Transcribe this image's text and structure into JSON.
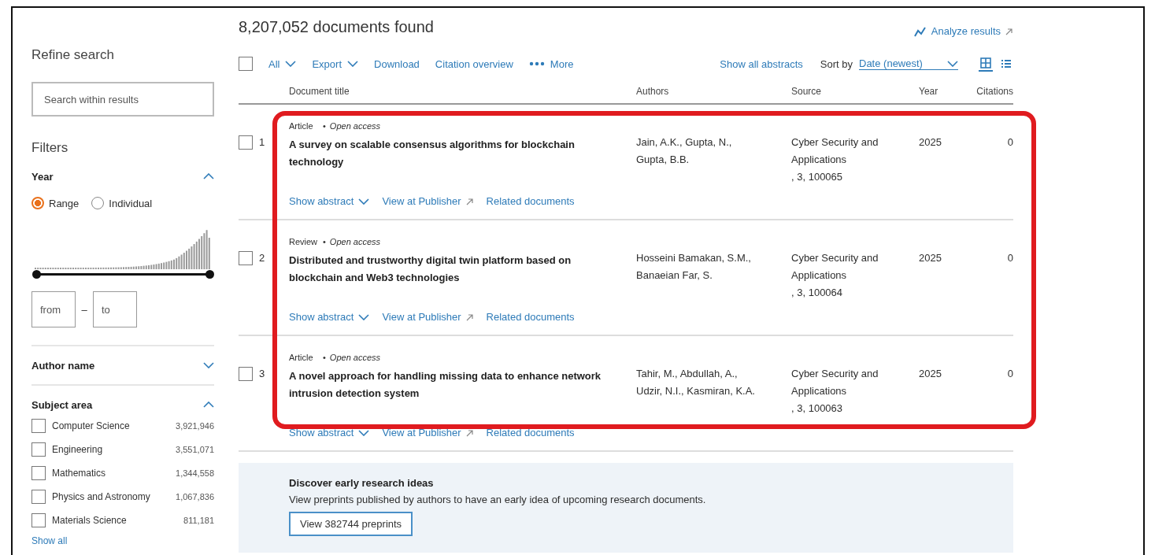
{
  "results_count": "8,207,052 documents found",
  "analyze_link": "Analyze results",
  "sidebar": {
    "title": "Refine search",
    "search": {
      "placeholder": "Search within results"
    },
    "filters_title": "Filters",
    "year": {
      "label": "Year",
      "expanded": true,
      "modes": [
        {
          "label": "Range",
          "selected": true
        },
        {
          "label": "Individual",
          "selected": false
        }
      ],
      "range_low": {
        "level": 0
      },
      "range_high": {
        "level": 1
      },
      "from": {
        "placeholder": "from"
      },
      "separator": "–",
      "to": {
        "placeholder": "to"
      }
    },
    "sections": [
      {
        "label": "Author name",
        "expanded": false
      },
      {
        "label": "Subject area",
        "expanded": true,
        "items": [
          {
            "label": "Computer Science",
            "count": "3,921,946",
            "checked": false
          },
          {
            "label": "Engineering",
            "count": "3,551,071",
            "checked": false
          },
          {
            "label": "Mathematics",
            "count": "1,344,558",
            "checked": false
          },
          {
            "label": "Physics and Astronomy",
            "count": "1,067,836",
            "checked": false
          },
          {
            "label": "Materials Science",
            "count": "811,181",
            "checked": false
          }
        ],
        "show_all": "Show all"
      }
    ]
  },
  "toolbar": {
    "select_all_checked": false,
    "actions": [
      {
        "label": "All",
        "kind": "dropdown"
      },
      {
        "label": "Export",
        "kind": "dropdown"
      },
      {
        "label": "Download",
        "kind": "link"
      },
      {
        "label": "Citation overview",
        "kind": "link"
      },
      {
        "label": "More",
        "kind": "more"
      }
    ],
    "show_all_abstracts": "Show all abstracts",
    "sort_label": "Sort by",
    "sort_value": "Date (newest)",
    "views": [
      {
        "kind": "grid",
        "selected": true
      },
      {
        "kind": "list",
        "selected": false
      }
    ]
  },
  "table": {
    "columns": [
      "Document title",
      "Authors",
      "Source",
      "Year",
      "Citations"
    ],
    "rows": [
      {
        "number": "1",
        "checked": false,
        "type": "Article",
        "separator": "•",
        "access": "Open access",
        "title": "A survey on scalable consensus algorithms for blockchain technology",
        "authors": [
          "Jain, A.K., Gupta, N.,",
          "Gupta, B.B."
        ],
        "source": "Cyber Security and Applications",
        "source_detail": ", 3, 100065",
        "year": "2025",
        "citations": "0",
        "links": [
          {
            "label": "Show abstract",
            "kind": "expand"
          },
          {
            "label": "View at Publisher",
            "kind": "external"
          },
          {
            "label": "Related documents",
            "kind": "link"
          }
        ]
      },
      {
        "number": "2",
        "checked": false,
        "type": "Review",
        "separator": "•",
        "access": "Open access",
        "title": "Distributed and trustworthy digital twin platform based on blockchain and Web3 technologies",
        "authors": [
          "Hosseini Bamakan, S.M.,",
          "Banaeian Far, S."
        ],
        "source": "Cyber Security and Applications",
        "source_detail": ", 3, 100064",
        "year": "2025",
        "citations": "0",
        "links": [
          {
            "label": "Show abstract",
            "kind": "expand"
          },
          {
            "label": "View at Publisher",
            "kind": "external"
          },
          {
            "label": "Related documents",
            "kind": "link"
          }
        ]
      },
      {
        "number": "3",
        "checked": false,
        "type": "Article",
        "separator": "•",
        "access": "Open access",
        "title": "A novel approach for handling missing data to enhance network intrusion detection system",
        "authors": [
          "Tahir, M., Abdullah, A.,",
          "Udzir, N.I., Kasmiran, K.A."
        ],
        "source": "Cyber Security and Applications",
        "source_detail": ", 3, 100063",
        "year": "2025",
        "citations": "0",
        "links": [
          {
            "label": "Show abstract",
            "kind": "expand"
          },
          {
            "label": "View at Publisher",
            "kind": "external"
          },
          {
            "label": "Related documents",
            "kind": "link"
          }
        ]
      }
    ]
  },
  "banner": {
    "title": "Discover early research ideas",
    "text": "View preprints published by authors to have an early idea of upcoming research documents.",
    "button": "View 382744 preprints"
  }
}
